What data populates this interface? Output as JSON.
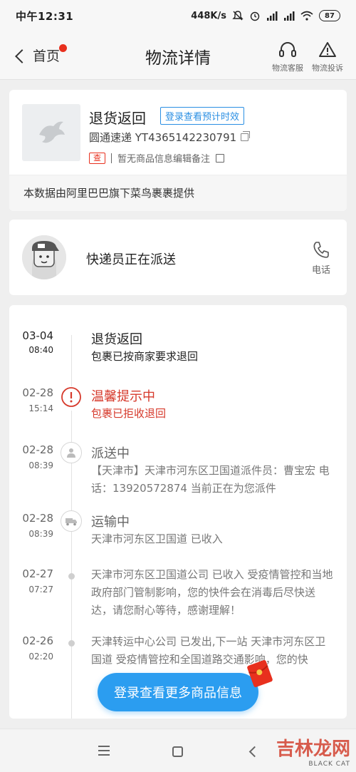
{
  "status_bar": {
    "time": "中午12:31",
    "network_speed": "448K/s",
    "battery": "87"
  },
  "header": {
    "back_label": "首页",
    "title": "物流详情",
    "customer_service_label": "物流客服",
    "complaint_label": "物流投诉"
  },
  "package": {
    "status": "退货返回",
    "login_tag": "登录查看预计时效",
    "courier": "圆通速递 YT4365142230791",
    "tag": "查",
    "note": "暂无商品信息编辑备注",
    "data_source": "本数据由阿里巴巴旗下菜鸟裹裹提供"
  },
  "courier_card": {
    "message": "快递员正在派送",
    "phone_label": "电话"
  },
  "timeline": [
    {
      "date": "03-04",
      "time": "08:40",
      "title": "退货返回",
      "desc": "包裹已按商家要求退回",
      "state": "active",
      "icon": "none-icon"
    },
    {
      "date": "02-28",
      "time": "15:14",
      "title": "温馨提示中",
      "desc": "包裹已拒收退回",
      "state": "warn",
      "icon": "alert-icon"
    },
    {
      "date": "02-28",
      "time": "08:39",
      "title": "派送中",
      "desc": "【天津市】天津市河东区卫国道派件员：曹宝宏 电话：13920572874 当前正在为您派件",
      "state": "normal",
      "icon": "person-icon"
    },
    {
      "date": "02-28",
      "time": "08:39",
      "title": "运输中",
      "desc": "天津市河东区卫国道 已收入",
      "state": "normal",
      "icon": "truck-icon"
    },
    {
      "date": "02-27",
      "time": "07:27",
      "title": "",
      "desc": "天津市河东区卫国道公司 已收入 受疫情管控和当地政府部门管制影响，您的快件会在消毒后尽快送达，请您耐心等待，感谢理解！",
      "state": "normal",
      "icon": "dot-icon"
    },
    {
      "date": "02-26",
      "time": "02:20",
      "title": "",
      "desc": "天津转运中心公司 已发出,下一站 天津市河东区卫国道 受疫情管控和全国道路交通影响，您的快",
      "state": "normal",
      "icon": "dot-icon"
    }
  ],
  "float_button": "登录查看更多商品信息",
  "watermark": {
    "text": "吉林龙网",
    "sub": "BLACK CAT"
  }
}
